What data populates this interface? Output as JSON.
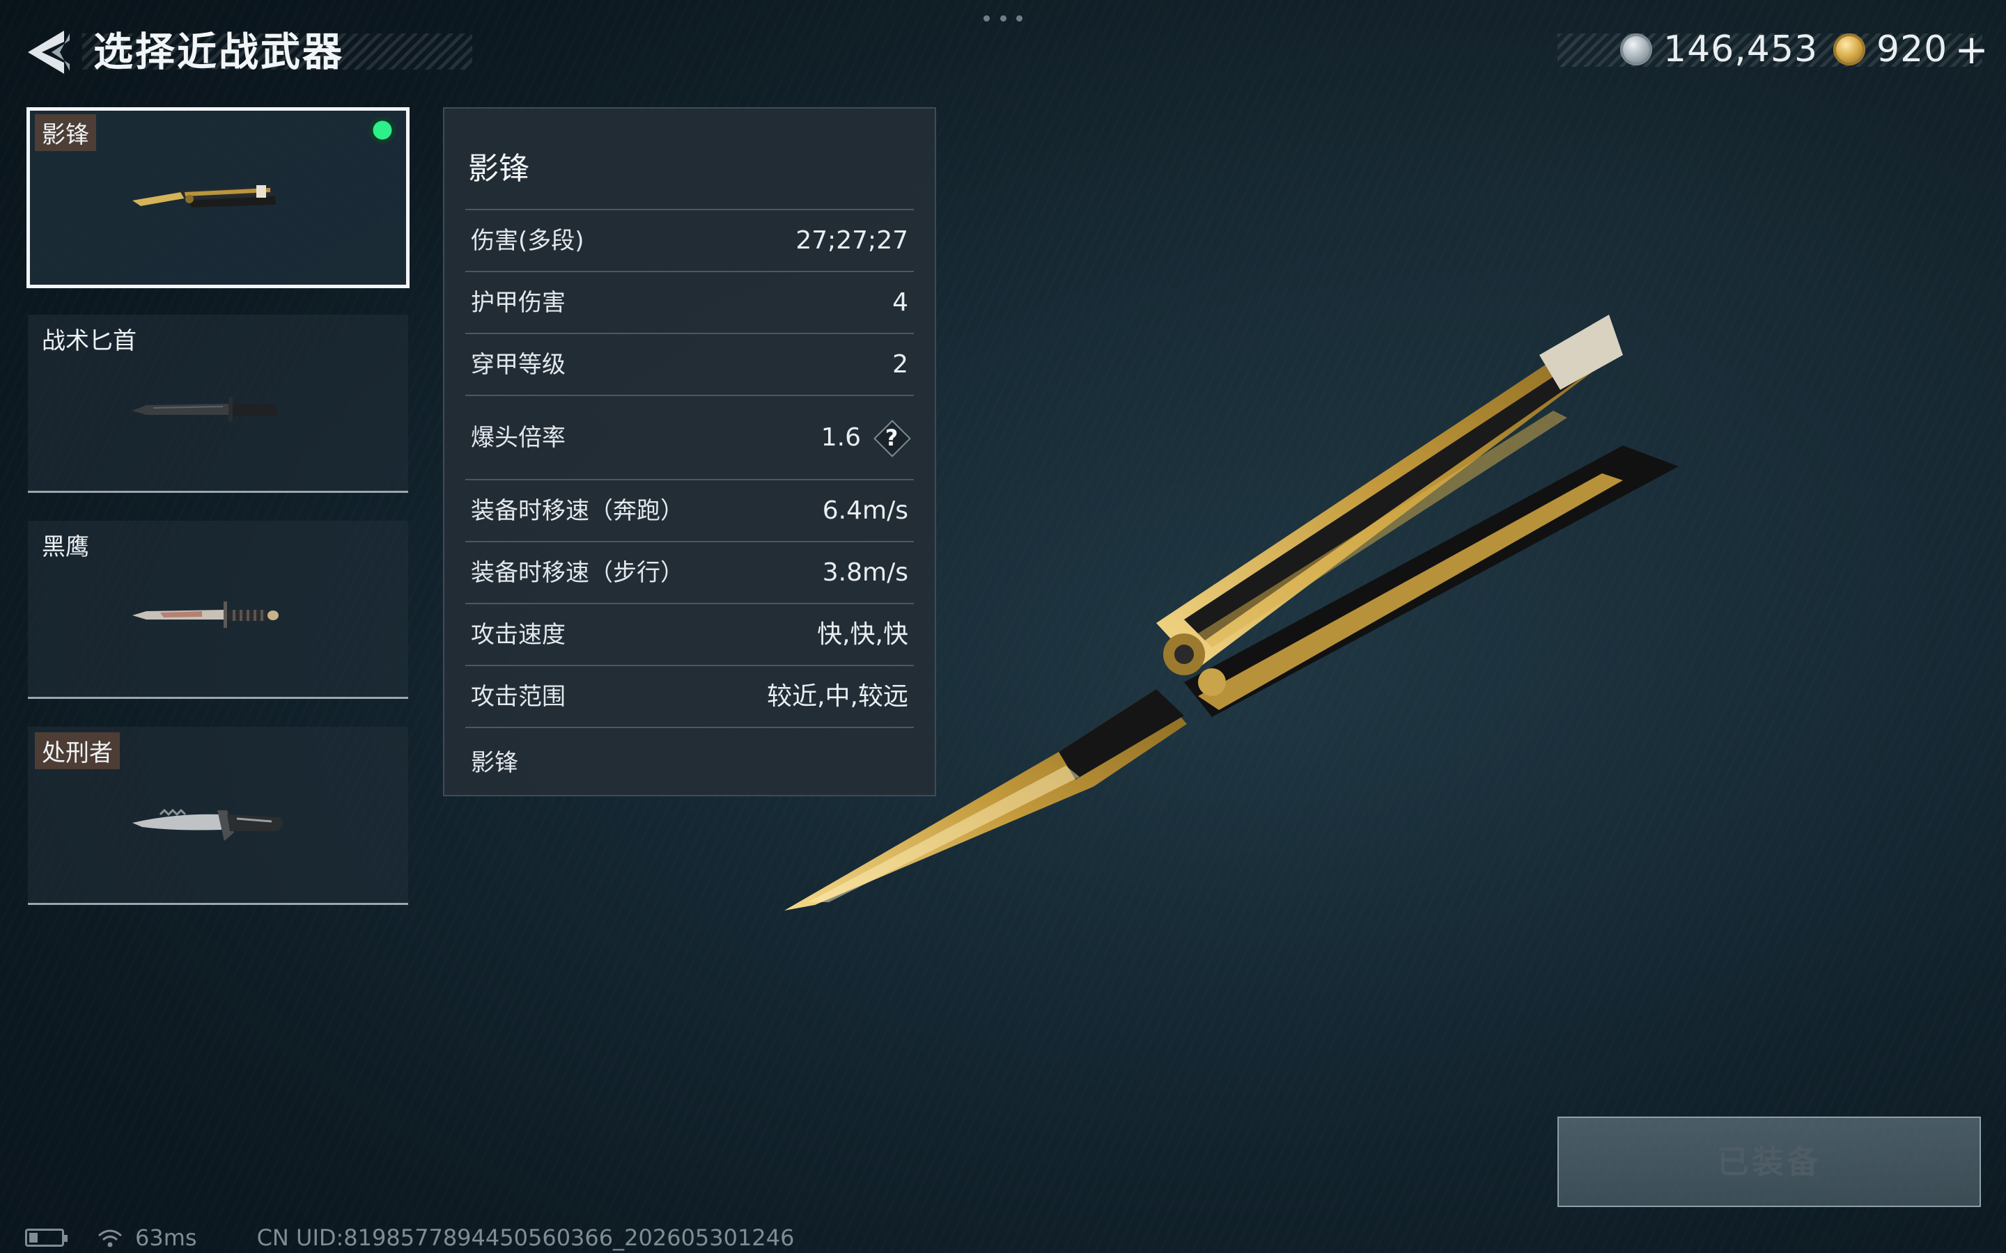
{
  "header": {
    "title": "选择近战武器",
    "currency": [
      {
        "icon": "silver-coin-icon",
        "value": "146,453"
      },
      {
        "icon": "gold-coin-icon",
        "value": "920"
      }
    ],
    "plus": "+"
  },
  "weapons": [
    {
      "name": "影锋",
      "selected": true,
      "equipped": true,
      "icon": "butterfly-knife-icon"
    },
    {
      "name": "战术匕首",
      "selected": false,
      "equipped": false,
      "icon": "tactical-dagger-icon"
    },
    {
      "name": "黑鹰",
      "selected": false,
      "equipped": false,
      "icon": "blackhawk-knife-icon"
    },
    {
      "name": "处刑者",
      "selected": false,
      "equipped": false,
      "icon": "executioner-knife-icon"
    }
  ],
  "panel": {
    "title": "影锋",
    "stats": [
      {
        "label": "伤害(多段)",
        "value": "27;27;27"
      },
      {
        "label": "护甲伤害",
        "value": "4"
      },
      {
        "label": "穿甲等级",
        "value": "2"
      },
      {
        "label": "爆头倍率",
        "value": "1.6",
        "help": "?"
      },
      {
        "label": "装备时移速（奔跑）",
        "value": "6.4m/s"
      },
      {
        "label": "装备时移速（步行）",
        "value": "3.8m/s"
      },
      {
        "label": "攻击速度",
        "value": "快,快,快"
      },
      {
        "label": "攻击范围",
        "value": "较近,中,较远"
      }
    ],
    "description": "影锋"
  },
  "equip_button": {
    "label": "已装备"
  },
  "footer": {
    "ping": "63ms",
    "uid": "CN UID:8198577894450560366_202605301246"
  },
  "colors": {
    "accent_green": "#2ef08a",
    "gold": "#d6a948",
    "background": "#142631"
  }
}
